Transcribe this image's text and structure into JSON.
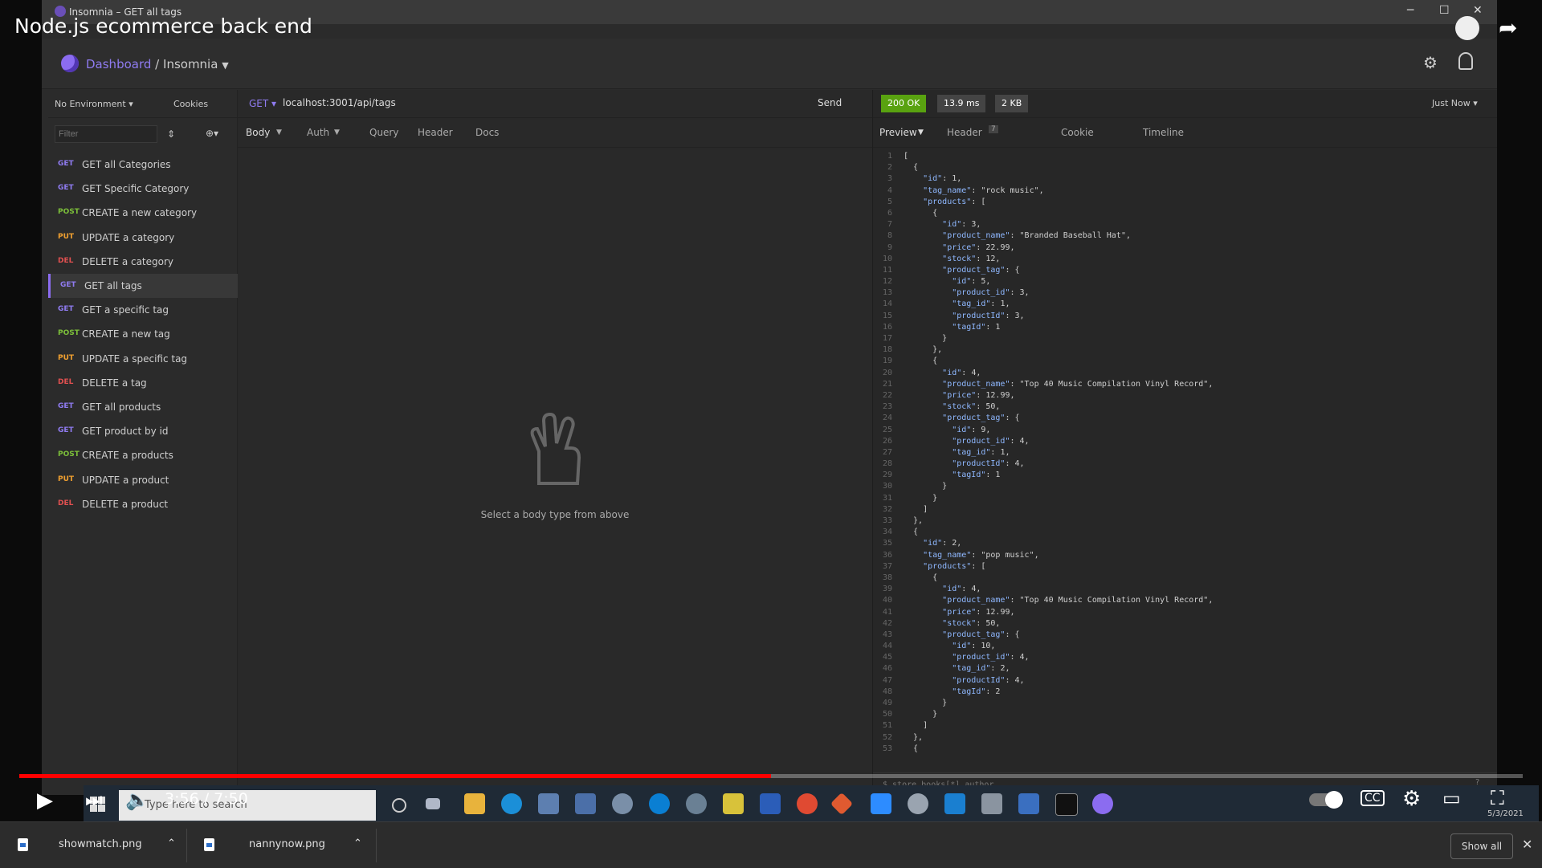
{
  "video": {
    "title": "Node.js ecommerce back end",
    "time_current": "3:56",
    "time_separator": "/",
    "time_total": "7:50",
    "progress": 0.5
  },
  "app": {
    "window_title": "Insomnia – GET all tags",
    "breadcrumb_root": "Dashboard",
    "breadcrumb_sep": "/",
    "breadcrumb_current": "Insomnia",
    "environment": "No Environment",
    "cookies_label": "Cookies",
    "filter_placeholder": "Filter",
    "requests": [
      {
        "method": "GET",
        "label": "GET all Categories",
        "color": "#8f7bf0"
      },
      {
        "method": "GET",
        "label": "GET Specific Category",
        "color": "#8f7bf0"
      },
      {
        "method": "POST",
        "label": "CREATE a new category",
        "color": "#7cbf3a"
      },
      {
        "method": "PUT",
        "label": "UPDATE a category",
        "color": "#f0a030"
      },
      {
        "method": "DEL",
        "label": "DELETE a category",
        "color": "#e05050"
      },
      {
        "method": "GET",
        "label": "GET all tags",
        "color": "#8f7bf0",
        "active": true
      },
      {
        "method": "GET",
        "label": "GET a specific tag",
        "color": "#8f7bf0"
      },
      {
        "method": "POST",
        "label": "CREATE a new tag",
        "color": "#7cbf3a"
      },
      {
        "method": "PUT",
        "label": "UPDATE a specific tag",
        "color": "#f0a030"
      },
      {
        "method": "DEL",
        "label": "DELETE a tag",
        "color": "#e05050"
      },
      {
        "method": "GET",
        "label": "GET all products",
        "color": "#8f7bf0"
      },
      {
        "method": "GET",
        "label": "GET product by id",
        "color": "#8f7bf0"
      },
      {
        "method": "POST",
        "label": "CREATE a products",
        "color": "#7cbf3a"
      },
      {
        "method": "PUT",
        "label": "UPDATE a product",
        "color": "#f0a030"
      },
      {
        "method": "DEL",
        "label": "DELETE a product",
        "color": "#e05050"
      }
    ],
    "request": {
      "method": "GET",
      "url": "localhost:3001/api/tags",
      "send_label": "Send",
      "tabs": [
        "Body",
        "Auth",
        "Query",
        "Header",
        "Docs"
      ],
      "empty_body_text": "Select a body type from above"
    },
    "response": {
      "status": "200 OK",
      "time": "13.9 ms",
      "size": "2 KB",
      "when": "Just Now",
      "tabs": [
        "Preview",
        "Header",
        "Cookie",
        "Timeline"
      ],
      "header_count": "7",
      "filter_placeholder": "$.store.books[*].author"
    }
  },
  "code_lines": [
    "[",
    "  {",
    "    \"id\": 1,",
    "    \"tag_name\": \"rock music\",",
    "    \"products\": [",
    "      {",
    "        \"id\": 3,",
    "        \"product_name\": \"Branded Baseball Hat\",",
    "        \"price\": 22.99,",
    "        \"stock\": 12,",
    "        \"product_tag\": {",
    "          \"id\": 5,",
    "          \"product_id\": 3,",
    "          \"tag_id\": 1,",
    "          \"productId\": 3,",
    "          \"tagId\": 1",
    "        }",
    "      },",
    "      {",
    "        \"id\": 4,",
    "        \"product_name\": \"Top 40 Music Compilation Vinyl Record\",",
    "        \"price\": 12.99,",
    "        \"stock\": 50,",
    "        \"product_tag\": {",
    "          \"id\": 9,",
    "          \"product_id\": 4,",
    "          \"tag_id\": 1,",
    "          \"productId\": 4,",
    "          \"tagId\": 1",
    "        }",
    "      }",
    "    ]",
    "  },",
    "  {",
    "    \"id\": 2,",
    "    \"tag_name\": \"pop music\",",
    "    \"products\": [",
    "      {",
    "        \"id\": 4,",
    "        \"product_name\": \"Top 40 Music Compilation Vinyl Record\",",
    "        \"price\": 12.99,",
    "        \"stock\": 50,",
    "        \"product_tag\": {",
    "          \"id\": 10,",
    "          \"product_id\": 4,",
    "          \"tag_id\": 2,",
    "          \"productId\": 4,",
    "          \"tagId\": 2",
    "        }",
    "      }",
    "    ]",
    "  },",
    "  {"
  ],
  "taskbar": {
    "search_placeholder": "Type here to search",
    "date": "5/3/2021"
  },
  "downloads": {
    "items": [
      "showmatch.png",
      "nannynow.png"
    ],
    "show_all": "Show all"
  }
}
